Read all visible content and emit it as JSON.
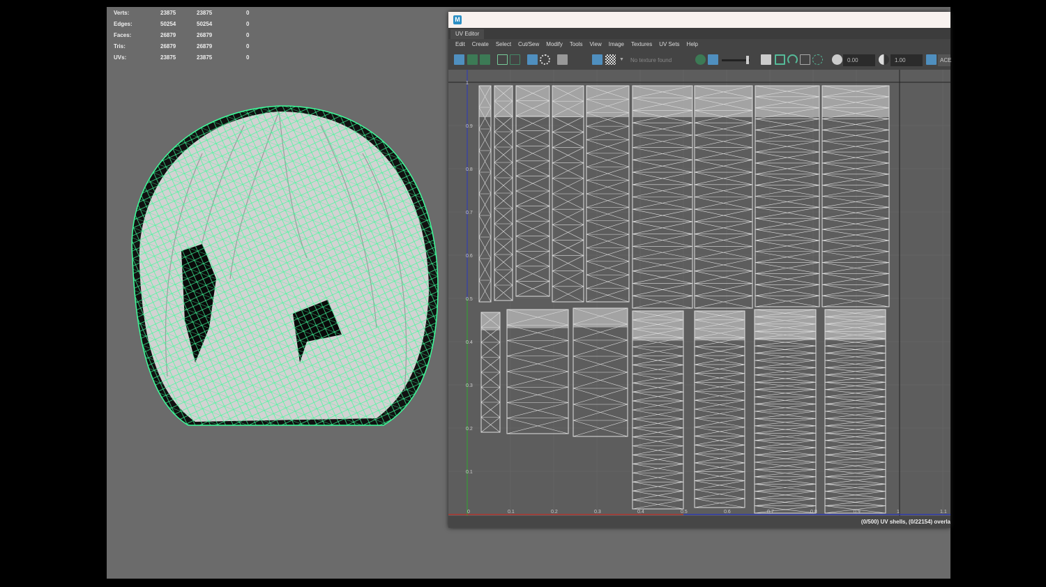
{
  "stats": [
    {
      "label": "Verts:",
      "a": "23875",
      "b": "23875",
      "c": "0"
    },
    {
      "label": "Edges:",
      "a": "50254",
      "b": "50254",
      "c": "0"
    },
    {
      "label": "Faces:",
      "a": "26879",
      "b": "26879",
      "c": "0"
    },
    {
      "label": "Tris:",
      "a": "26879",
      "b": "26879",
      "c": "0"
    },
    {
      "label": "UVs:",
      "a": "23875",
      "b": "23875",
      "c": "0"
    }
  ],
  "uv_editor": {
    "logo": "M",
    "tab": "UV Editor",
    "menu": [
      "Edit",
      "Create",
      "Select",
      "Cut/Sew",
      "Modify",
      "Tools",
      "View",
      "Image",
      "Textures",
      "UV Sets",
      "Help"
    ],
    "texture_placeholder": "No texture found",
    "exposure": "0.00",
    "gamma": "1.00",
    "colorspace": "ACE",
    "status": "(0/500) UV shells, (0/22154) overla",
    "u_ticks": [
      "0",
      "0.1",
      "0.2",
      "0.3",
      "0.4",
      "0.5",
      "0.6",
      "0.7",
      "0.8",
      "0.9",
      "1",
      "1.1"
    ],
    "v_ticks": [
      "0.1",
      "0.2",
      "0.3",
      "0.4",
      "0.5",
      "0.6",
      "0.7",
      "0.8",
      "0.9",
      "1"
    ],
    "colors": {
      "u_axis": "#c0302a",
      "v_axis": "#2a36c0",
      "v_axis_green": "#2fa830",
      "wire": "#e0e0e0",
      "mesh": "#3dfc9a"
    }
  }
}
